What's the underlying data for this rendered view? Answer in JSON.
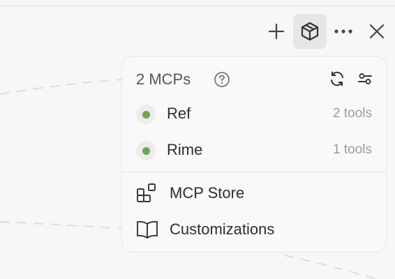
{
  "toolbar": {
    "buttons": [
      {
        "name": "add-button",
        "icon": "plus-icon"
      },
      {
        "name": "mcp-button",
        "icon": "cube-icon",
        "active": true
      },
      {
        "name": "more-button",
        "icon": "more-horizontal-icon"
      },
      {
        "name": "close-button",
        "icon": "close-icon"
      }
    ]
  },
  "panel": {
    "title": "2 MCPs",
    "icons": [
      "help-icon",
      "refresh-icon",
      "settings-sliders-icon"
    ],
    "mcps": [
      {
        "name": "Ref",
        "tools": "2 tools",
        "status_color": "#6aa84f"
      },
      {
        "name": "Rime",
        "tools": "1 tools",
        "status_color": "#6aa84f"
      }
    ],
    "menu": [
      {
        "label": "MCP Store",
        "icon": "store-icon"
      },
      {
        "label": "Customizations",
        "icon": "book-icon"
      }
    ]
  },
  "colors": {
    "background": "#f7f7f7",
    "panel": "#f9f9f9",
    "status_green": "#6aa84f"
  }
}
